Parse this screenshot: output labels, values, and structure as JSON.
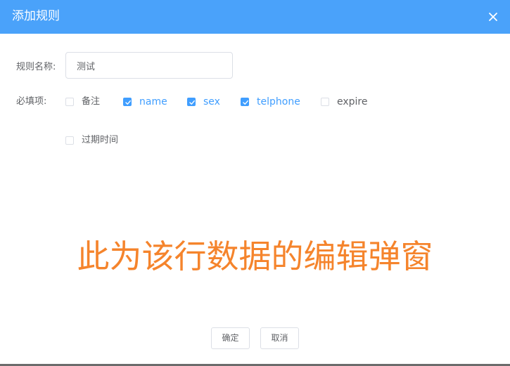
{
  "dialog": {
    "title": "添加规则",
    "close_icon": "close-icon"
  },
  "form": {
    "name_label": "规则名称:",
    "name_value": "测试",
    "required_label": "必填项:",
    "checkboxes": [
      {
        "label": "备注",
        "checked": false
      },
      {
        "label": "name",
        "checked": true
      },
      {
        "label": "sex",
        "checked": true
      },
      {
        "label": "telphone",
        "checked": true
      },
      {
        "label": "expire",
        "checked": false
      },
      {
        "label": "过期时间",
        "checked": false
      }
    ]
  },
  "annotation": "此为该行数据的编辑弹窗",
  "footer": {
    "confirm_label": "确定",
    "cancel_label": "取消"
  },
  "colors": {
    "header": "#4aa2fa",
    "primary": "#409eff",
    "annotation": "#f5842c"
  }
}
